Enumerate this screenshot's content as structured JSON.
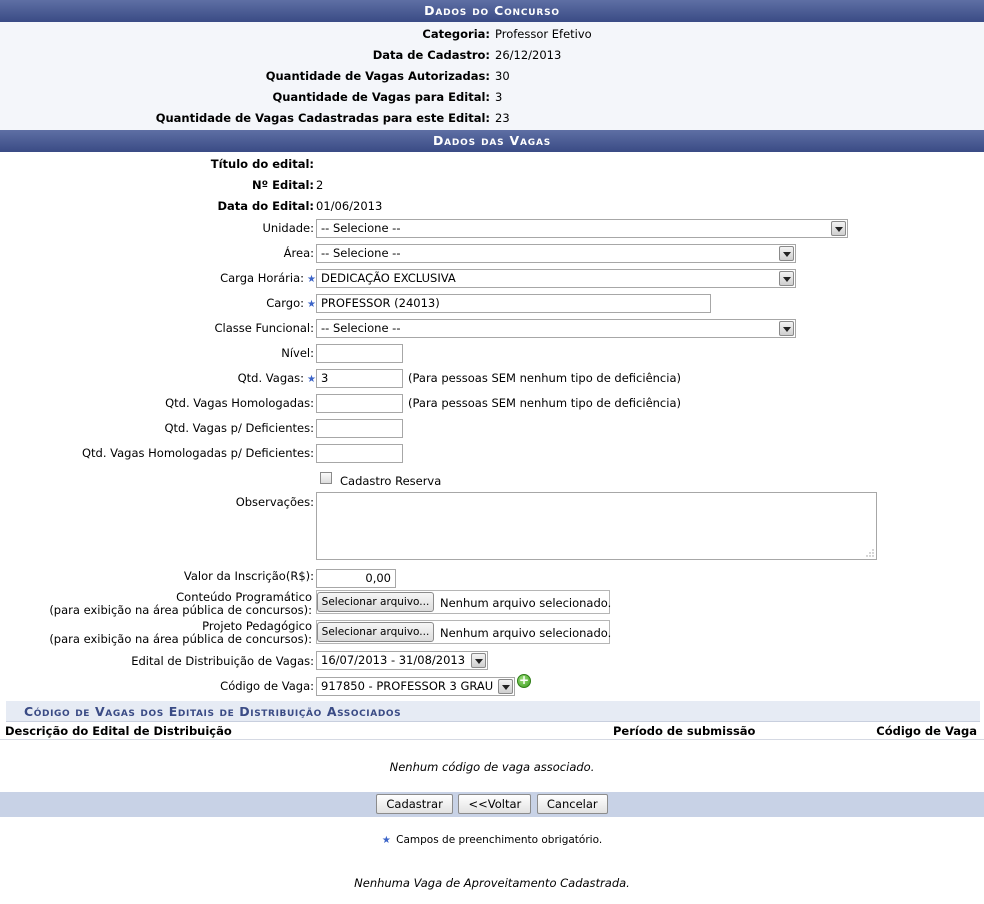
{
  "concurso": {
    "header": "Dados do Concurso",
    "fields": [
      {
        "label": "Categoria:",
        "value": "Professor Efetivo"
      },
      {
        "label": "Data de Cadastro:",
        "value": "26/12/2013"
      },
      {
        "label": "Quantidade de Vagas Autorizadas:",
        "value": "30"
      },
      {
        "label": "Quantidade de Vagas para Edital:",
        "value": "3"
      },
      {
        "label": "Quantidade de Vagas Cadastradas para este Edital:",
        "value": "23"
      }
    ]
  },
  "vagas": {
    "header": "Dados das Vagas",
    "titulo_label": "Título do edital:",
    "titulo_value": "",
    "numero_label": "Nº Edital:",
    "numero_value": "2",
    "data_label": "Data do Edital:",
    "data_value": "01/06/2013",
    "unidade_label": "Unidade:",
    "unidade_value": "-- Selecione --",
    "area_label": "Área:",
    "area_value": "-- Selecione --",
    "carga_label": "Carga Horária:",
    "carga_value": "DEDICAÇÃO EXCLUSIVA",
    "cargo_label": "Cargo:",
    "cargo_value": "PROFESSOR (24013)",
    "classe_label": "Classe Funcional:",
    "classe_value": "-- Selecione --",
    "nivel_label": "Nível:",
    "nivel_value": "",
    "qtd_label": "Qtd. Vagas:",
    "qtd_value": "3",
    "qtd_hint": "(Para pessoas SEM nenhum tipo de deficiência)",
    "qtd_hom_label": "Qtd. Vagas Homologadas:",
    "qtd_hom_value": "",
    "qtd_hom_hint": "(Para pessoas SEM nenhum tipo de deficiência)",
    "qtd_def_label": "Qtd. Vagas p/ Deficientes:",
    "qtd_def_value": "",
    "qtd_hom_def_label": "Qtd. Vagas Homologadas p/ Deficientes:",
    "qtd_hom_def_value": "",
    "reserva_label": "Cadastro Reserva",
    "obs_label": "Observações:",
    "valor_label": "Valor da Inscrição(R$):",
    "valor_value": "0,00",
    "conteudo_label": "Conteúdo Programático",
    "conteudo_sub": "(para exibição na área pública de concursos):",
    "projeto_label": "Projeto Pedagógico",
    "projeto_sub": "(para exibição na área pública de concursos):",
    "file_button": "Selecionar arquivo...",
    "file_none": "Nenhum arquivo selecionado.",
    "distrib_label": "Edital de Distribuição de Vagas:",
    "distrib_value": "16/07/2013 - 31/08/2013",
    "codigo_label": "Código de Vaga:",
    "codigo_value": "917850 - PROFESSOR 3 GRAU"
  },
  "associados": {
    "title": "Código de Vagas dos Editais de Distribuição Associados",
    "col_descricao": "Descrição do Edital de Distribuição",
    "col_periodo": "Período de submissão",
    "col_codigo": "Código de Vaga",
    "empty": "Nenhum código de vaga associado."
  },
  "buttons": {
    "cadastrar": "Cadastrar",
    "voltar": "<<Voltar",
    "cancelar": "Cancelar"
  },
  "footer": {
    "required_star": "★",
    "required_note": "Campos de preenchimento obrigatório.",
    "aproveitamento": "Nenhuma Vaga de Aproveitamento Cadastrada."
  },
  "colors": {
    "header": "#3a4b85",
    "required": "#3b64c8",
    "button_bar": "#c8d2e6"
  }
}
